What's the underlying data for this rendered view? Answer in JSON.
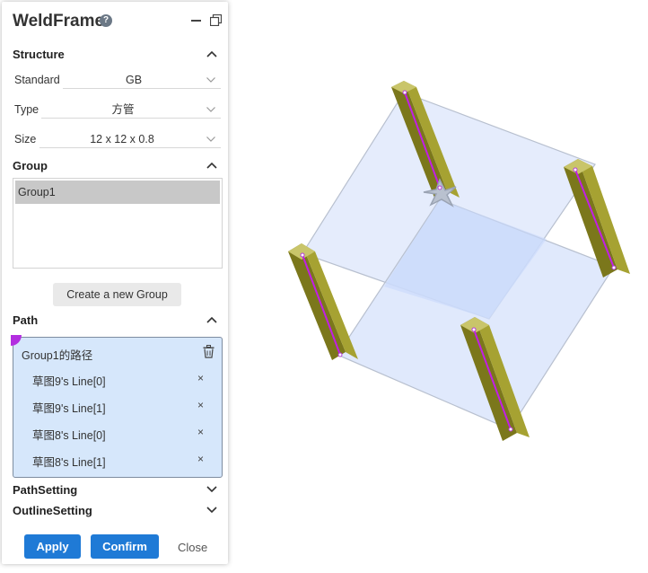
{
  "panel": {
    "title": "WeldFrame",
    "help_glyph": "?"
  },
  "structure": {
    "heading": "Structure",
    "standard_label": "Standard",
    "standard_value": "GB",
    "type_label": "Type",
    "type_value": "方管",
    "size_label": "Size",
    "size_value": "12 x 12 x 0.8"
  },
  "group": {
    "heading": "Group",
    "items": [
      "Group1"
    ],
    "new_button": "Create a new Group"
  },
  "path": {
    "heading": "Path",
    "group_title": "Group1的路径",
    "lines": [
      "草图9's Line[0]",
      "草图9's Line[1]",
      "草图8's Line[0]",
      "草图8's Line[1]"
    ],
    "remove_glyph": "×"
  },
  "collapsed": {
    "path_setting": "PathSetting",
    "outline_setting": "OutlineSetting"
  },
  "footer": {
    "apply": "Apply",
    "confirm": "Confirm",
    "close": "Close"
  },
  "colors": {
    "accent": "#1f7ad6",
    "path_highlight": "#d6e7fb",
    "path_curve": "#c21ee6",
    "tube": "#8a8520",
    "plane_fill": "#d8e4fb"
  }
}
